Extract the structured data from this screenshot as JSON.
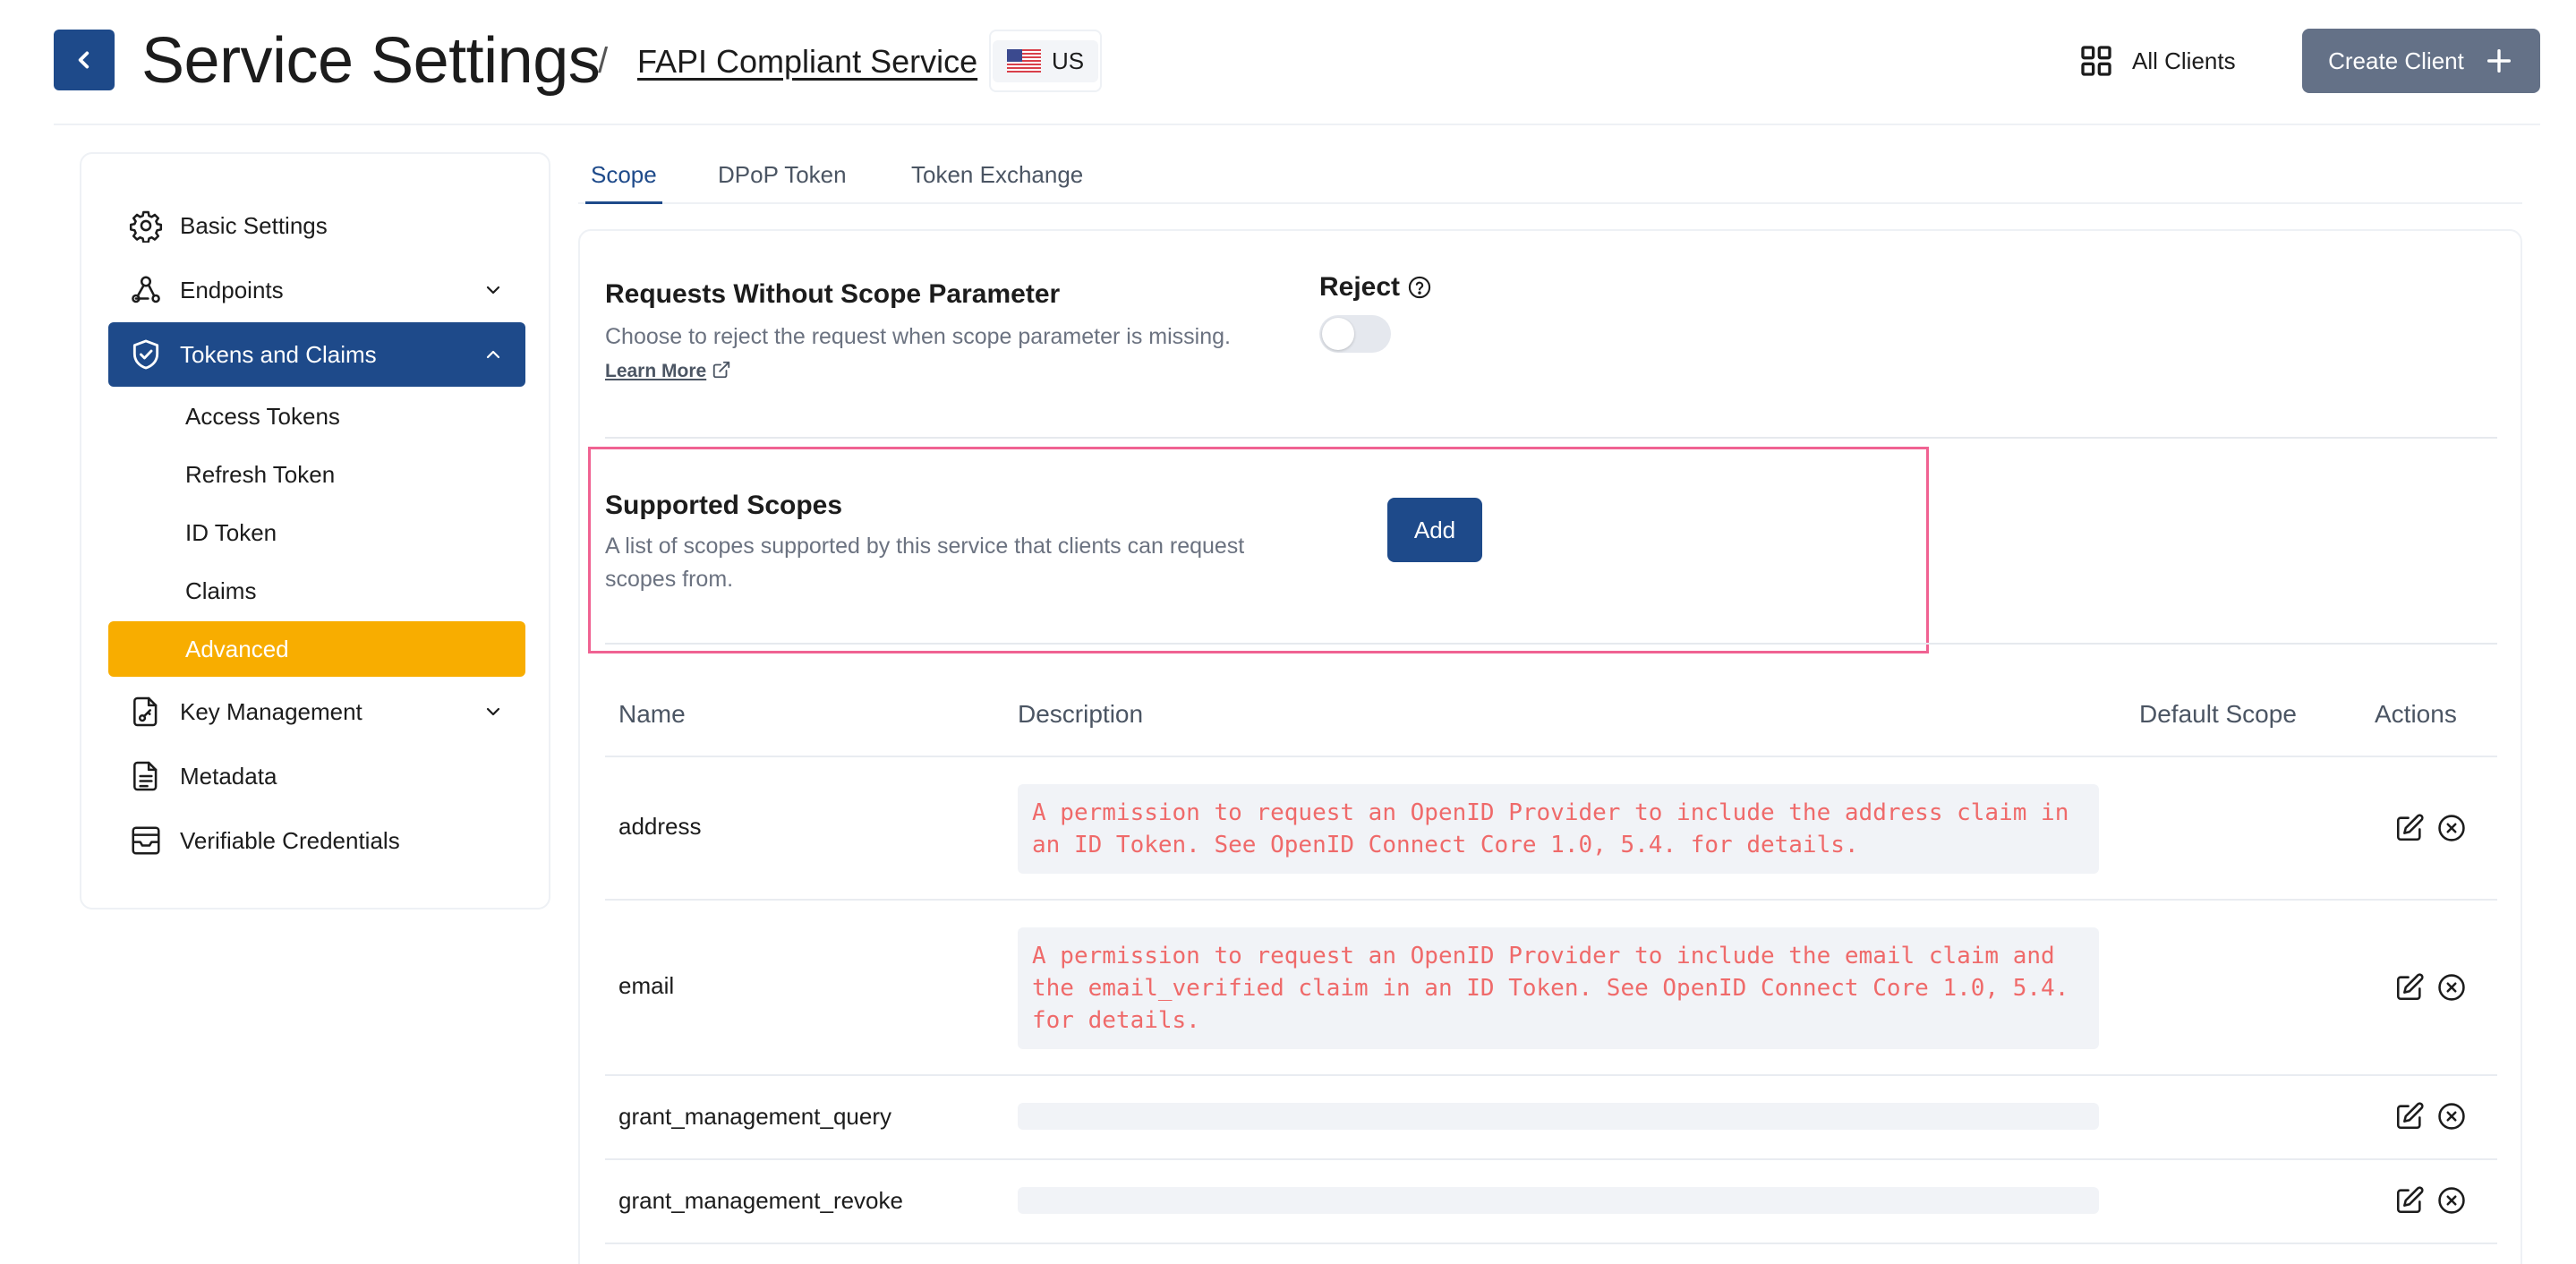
{
  "header": {
    "title": "Service Settings",
    "separator": "/",
    "service_name": "FAPI Compliant Service",
    "region": "US",
    "all_clients_label": "All Clients",
    "create_client_label": "Create Client"
  },
  "sidebar": {
    "items": [
      {
        "label": "Basic Settings",
        "icon": "gear-icon"
      },
      {
        "label": "Endpoints",
        "icon": "webhook-icon"
      },
      {
        "label": "Tokens and Claims",
        "icon": "shield-check-icon"
      },
      {
        "label": "Key Management",
        "icon": "file-key-icon"
      },
      {
        "label": "Metadata",
        "icon": "document-icon"
      },
      {
        "label": "Verifiable Credentials",
        "icon": "inbox-icon"
      }
    ],
    "sub_items": [
      "Access Tokens",
      "Refresh Token",
      "ID Token",
      "Claims",
      "Advanced"
    ]
  },
  "tabs": [
    "Scope",
    "DPoP Token",
    "Token Exchange"
  ],
  "scope_param": {
    "title": "Requests Without Scope Parameter",
    "description": "Choose to reject the request when scope parameter is missing.",
    "learn_more": "Learn More",
    "reject_label": "Reject",
    "reject_enabled": false
  },
  "supported_scopes": {
    "title": "Supported Scopes",
    "description": "A list of scopes supported by this service that clients can request scopes from.",
    "add_label": "Add"
  },
  "table": {
    "headers": [
      "Name",
      "Description",
      "Default Scope",
      "Actions"
    ],
    "rows": [
      {
        "name": "address",
        "description": "A permission to request an OpenID Provider to include the address claim in an ID Token. See OpenID Connect Core 1.0, 5.4. for details."
      },
      {
        "name": "email",
        "description": "A permission to request an OpenID Provider to include the email claim and the email_verified claim in an ID Token. See OpenID Connect Core 1.0, 5.4. for details."
      },
      {
        "name": "grant_management_query",
        "description": ""
      },
      {
        "name": "grant_management_revoke",
        "description": ""
      }
    ]
  },
  "colors": {
    "primary": "#1e4a8a",
    "accent": "#f8ad00",
    "highlight_border": "#f06292",
    "description_text": "#ef6a6a"
  }
}
